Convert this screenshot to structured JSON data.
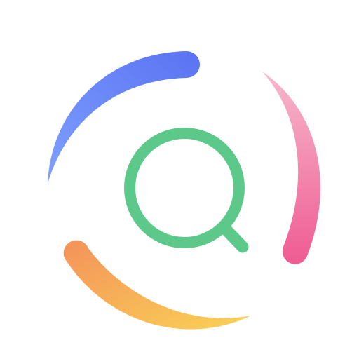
{
  "icon": {
    "name": "search-icon",
    "colors": {
      "background": "#ffffff",
      "magnifier": "#5cc98a",
      "arc_blue_start": "#7fa0ff",
      "arc_blue_end": "#5a73f2",
      "arc_pink_start": "#f6b8cc",
      "arc_pink_end": "#ef5b92",
      "arc_orange_start": "#f3925b",
      "arc_orange_end": "#fbd255"
    }
  }
}
